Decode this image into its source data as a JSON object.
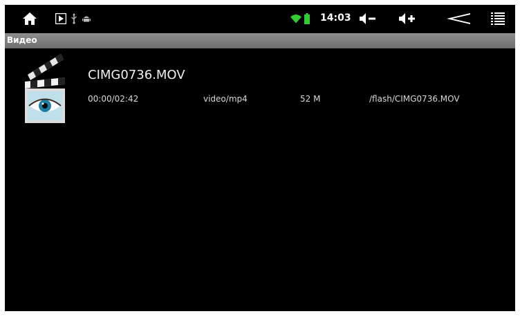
{
  "status_bar": {
    "icons": [
      "home-icon",
      "media-play-icon",
      "usb-icon",
      "android-debug-icon",
      "wifi-icon",
      "battery-icon",
      "volume-down-icon",
      "volume-up-icon",
      "back-icon",
      "menu-icon"
    ],
    "time": "14:03",
    "colors": {
      "wifi": "#33cc33",
      "battery": "#33cc33"
    }
  },
  "title_bar": {
    "title": "Видео"
  },
  "video_list": [
    {
      "name": "CIMG0736.MOV",
      "duration": "00:00/02:42",
      "mime": "video/mp4",
      "size": "52 M",
      "path": "/flash/CIMG0736.MOV",
      "thumbnail_icon": "clapperboard-eye-icon"
    }
  ]
}
